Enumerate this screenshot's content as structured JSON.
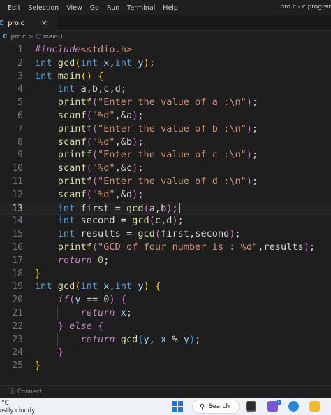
{
  "menubar": {
    "items": [
      "Edit",
      "Selection",
      "View",
      "Go",
      "Run",
      "Terminal",
      "Help"
    ],
    "window_title": "pro.c - c program"
  },
  "tab": {
    "label": "pro.c",
    "close": "×",
    "icon": "c-file-icon"
  },
  "breadcrumb": {
    "file": "pro.c",
    "separator": ">",
    "symbol": "main()"
  },
  "editor": {
    "current_line": 13,
    "line_numbers": [
      "1",
      "2",
      "3",
      "4",
      "5",
      "6",
      "7",
      "8",
      "9",
      "10",
      "11",
      "12",
      "13",
      "14",
      "15",
      "16",
      "17",
      "18",
      "19",
      "20",
      "21",
      "22",
      "23",
      "24",
      "25"
    ],
    "lines": [
      "#include<stdio.h>",
      "int gcd(int x,int y);",
      "int main() {",
      "    int a,b,c,d;",
      "    printf(\"Enter the value of a :\\n\");",
      "    scanf(\"%d\",&a);",
      "    printf(\"Enter the value of b :\\n\");",
      "    scanf(\"%d\",&b);",
      "    printf(\"Enter the value of c :\\n\");",
      "    scanf(\"%d\",&c);",
      "    printf(\"Enter the value of d :\\n\");",
      "    scanf(\"%d\",&d);",
      "    int first = gcd(a,b);",
      "    int second = gcd(c,d);",
      "    int results = gcd(first,second);",
      "    printf(\"GCD of four number is : %d\",results);",
      "    return 0;",
      "}",
      "int gcd(int x,int y) {",
      "    if(y == 0) {",
      "        return x;",
      "    } else {",
      "        return gcd(y, x % y);",
      "    }",
      "}"
    ]
  },
  "statusbar": {
    "connect_label": "Connect"
  },
  "taskbar": {
    "weather_temp": "°C",
    "weather_desc": "ostly cloudy",
    "search_label": "Search",
    "badge_count": "1"
  },
  "colors": {
    "keyword": "#569cd6",
    "control": "#c586c0",
    "function": "#dcdcaa",
    "string": "#ce9178",
    "number": "#b5cea8",
    "parameter": "#9cdcfe"
  }
}
